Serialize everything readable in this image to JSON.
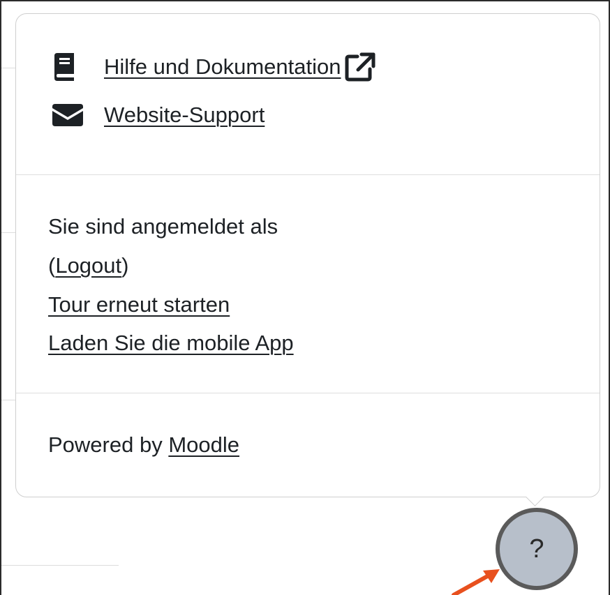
{
  "popover": {
    "links": {
      "help_docs": "Hilfe und Dokumentation",
      "site_support": "Website-Support"
    },
    "user": {
      "logged_in_as": "Sie sind angemeldet als",
      "logout_open": "(",
      "logout_label": "Logout",
      "logout_close": ")",
      "restart_tour": "Tour erneut starten",
      "mobile_app": "Laden Sie die mobile App"
    },
    "footer": {
      "powered_by": "Powered by ",
      "moodle": "Moodle"
    }
  },
  "help_button": {
    "label": "?"
  },
  "icons": {
    "help_docs": "book-icon",
    "site_support": "envelope-icon",
    "external": "external-link-icon",
    "annotation": "arrow-pointer-icon"
  },
  "colors": {
    "text": "#1d2125",
    "help_button_fill": "#b7bfca",
    "help_button_border": "#5a5a5a",
    "annotation_arrow": "#e8501e"
  }
}
